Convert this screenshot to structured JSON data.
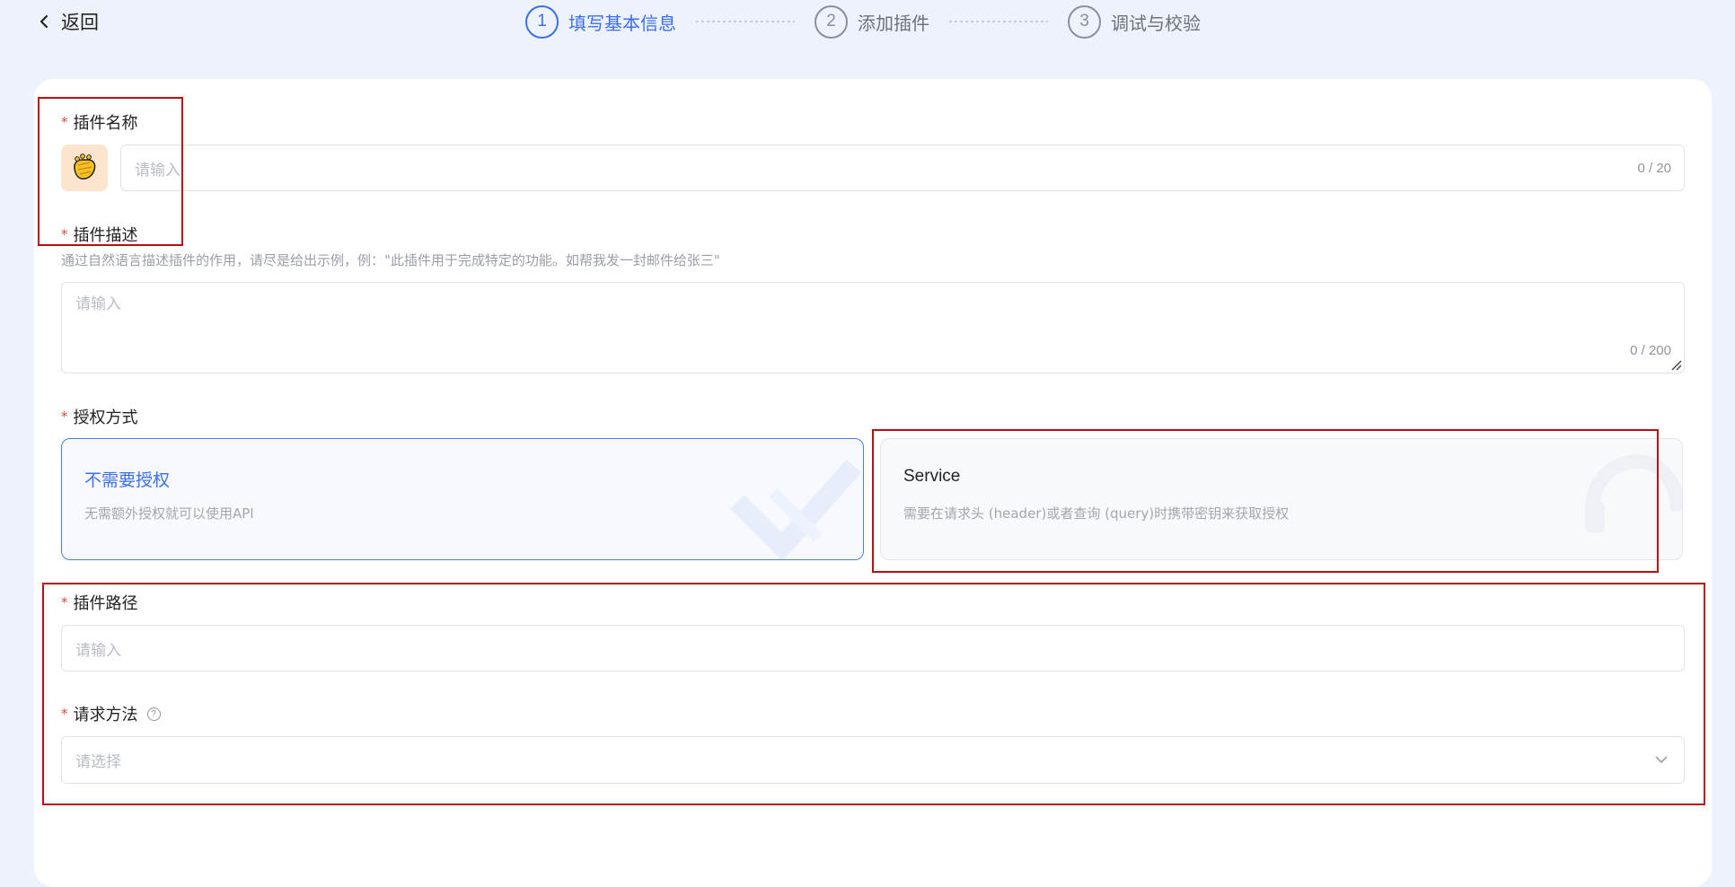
{
  "back": {
    "label": "返回"
  },
  "steps": [
    {
      "num": "1",
      "label": "填写基本信息",
      "active": true
    },
    {
      "num": "2",
      "label": "添加插件",
      "active": false
    },
    {
      "num": "3",
      "label": "调试与校验",
      "active": false
    }
  ],
  "form": {
    "name": {
      "label": "插件名称",
      "placeholder": "请输入",
      "counter": "0 / 20"
    },
    "description": {
      "label": "插件描述",
      "hint": "通过自然语言描述插件的作用，请尽是给出示例，例：\"此插件用于完成特定的功能。如帮我发一封邮件给张三\"",
      "placeholder": "请输入",
      "counter": "0 / 200"
    },
    "auth": {
      "label": "授权方式",
      "options": [
        {
          "title": "不需要授权",
          "desc": "无需额外授权就可以使用API",
          "selected": true
        },
        {
          "title": "Service",
          "desc": "需要在请求头 (header)或者查询 (query)时携带密钥来获取授权",
          "selected": false
        }
      ]
    },
    "path": {
      "label": "插件路径",
      "placeholder": "请输入"
    },
    "method": {
      "label": "请求方法",
      "placeholder": "请选择"
    }
  },
  "icons": {
    "back": "chevron-left-icon",
    "avatar": "clapping-hands-icon",
    "help": "question-circle-icon",
    "select": "chevron-down-icon"
  },
  "colors": {
    "primary": "#3a6ff0",
    "required": "#e2483d",
    "highlight": "#c00d14",
    "background": "#eef2fb"
  }
}
